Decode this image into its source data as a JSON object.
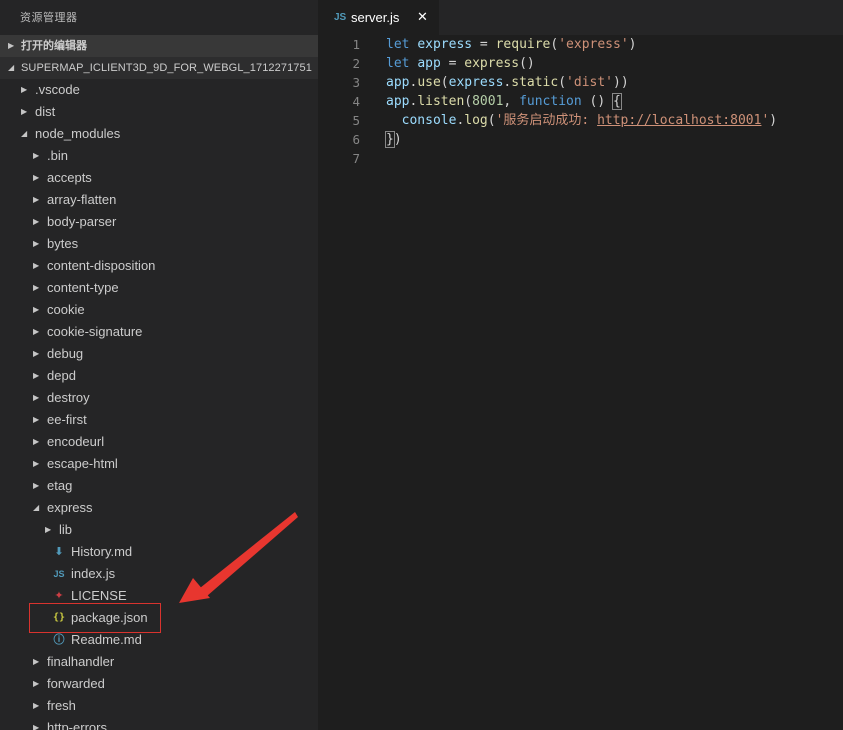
{
  "sidebar": {
    "title": "资源管理器",
    "open_editors": "打开的编辑器",
    "project": "SUPERMAP_ICLIENT3D_9D_FOR_WEBGL_1712271751",
    "tree": [
      {
        "label": ".vscode",
        "indent": 0,
        "kind": "folder",
        "open": false
      },
      {
        "label": "dist",
        "indent": 0,
        "kind": "folder",
        "open": false
      },
      {
        "label": "node_modules",
        "indent": 0,
        "kind": "folder",
        "open": true
      },
      {
        "label": ".bin",
        "indent": 1,
        "kind": "folder",
        "open": false
      },
      {
        "label": "accepts",
        "indent": 1,
        "kind": "folder",
        "open": false
      },
      {
        "label": "array-flatten",
        "indent": 1,
        "kind": "folder",
        "open": false
      },
      {
        "label": "body-parser",
        "indent": 1,
        "kind": "folder",
        "open": false
      },
      {
        "label": "bytes",
        "indent": 1,
        "kind": "folder",
        "open": false
      },
      {
        "label": "content-disposition",
        "indent": 1,
        "kind": "folder",
        "open": false
      },
      {
        "label": "content-type",
        "indent": 1,
        "kind": "folder",
        "open": false
      },
      {
        "label": "cookie",
        "indent": 1,
        "kind": "folder",
        "open": false
      },
      {
        "label": "cookie-signature",
        "indent": 1,
        "kind": "folder",
        "open": false
      },
      {
        "label": "debug",
        "indent": 1,
        "kind": "folder",
        "open": false
      },
      {
        "label": "depd",
        "indent": 1,
        "kind": "folder",
        "open": false
      },
      {
        "label": "destroy",
        "indent": 1,
        "kind": "folder",
        "open": false
      },
      {
        "label": "ee-first",
        "indent": 1,
        "kind": "folder",
        "open": false
      },
      {
        "label": "encodeurl",
        "indent": 1,
        "kind": "folder",
        "open": false
      },
      {
        "label": "escape-html",
        "indent": 1,
        "kind": "folder",
        "open": false
      },
      {
        "label": "etag",
        "indent": 1,
        "kind": "folder",
        "open": false
      },
      {
        "label": "express",
        "indent": 1,
        "kind": "folder",
        "open": true
      },
      {
        "label": "lib",
        "indent": 2,
        "kind": "folder",
        "open": false
      },
      {
        "label": "History.md",
        "indent": 2,
        "kind": "file",
        "icon": "markdown-arrow-icon"
      },
      {
        "label": "index.js",
        "indent": 2,
        "kind": "file",
        "icon": "js-file-icon"
      },
      {
        "label": "LICENSE",
        "indent": 2,
        "kind": "file",
        "icon": "license-icon"
      },
      {
        "label": "package.json",
        "indent": 2,
        "kind": "file",
        "icon": "json-file-icon"
      },
      {
        "label": "Readme.md",
        "indent": 2,
        "kind": "file",
        "icon": "info-icon"
      },
      {
        "label": "finalhandler",
        "indent": 1,
        "kind": "folder",
        "open": false
      },
      {
        "label": "forwarded",
        "indent": 1,
        "kind": "folder",
        "open": false
      },
      {
        "label": "fresh",
        "indent": 1,
        "kind": "folder",
        "open": false
      },
      {
        "label": "http-errors",
        "indent": 1,
        "kind": "folder",
        "open": false
      }
    ]
  },
  "editor": {
    "tab": {
      "icon_text": "JS",
      "label": "server.js",
      "close": "✕"
    },
    "lines": [
      {
        "n": "1",
        "tokens": [
          [
            "kw",
            "let"
          ],
          [
            "pl",
            " "
          ],
          [
            "var",
            "express"
          ],
          [
            "pl",
            " = "
          ],
          [
            "fn",
            "require"
          ],
          [
            "pl",
            "("
          ],
          [
            "str",
            "'express'"
          ],
          [
            "pl",
            ")"
          ]
        ]
      },
      {
        "n": "2",
        "tokens": [
          [
            "kw",
            "let"
          ],
          [
            "pl",
            " "
          ],
          [
            "var",
            "app"
          ],
          [
            "pl",
            " = "
          ],
          [
            "fn",
            "express"
          ],
          [
            "pl",
            "()"
          ]
        ]
      },
      {
        "n": "3",
        "tokens": [
          [
            "var",
            "app"
          ],
          [
            "pl",
            "."
          ],
          [
            "fn",
            "use"
          ],
          [
            "pl",
            "("
          ],
          [
            "var",
            "express"
          ],
          [
            "pl",
            "."
          ],
          [
            "fn",
            "static"
          ],
          [
            "pl",
            "("
          ],
          [
            "str",
            "'dist'"
          ],
          [
            "pl",
            "))"
          ]
        ]
      },
      {
        "n": "4",
        "tokens": [
          [
            "var",
            "app"
          ],
          [
            "pl",
            "."
          ],
          [
            "fn",
            "listen"
          ],
          [
            "pl",
            "("
          ],
          [
            "num",
            "8001"
          ],
          [
            "pl",
            ", "
          ],
          [
            "kw",
            "function"
          ],
          [
            "pl",
            " () "
          ],
          [
            "bm",
            "{"
          ]
        ]
      },
      {
        "n": "5",
        "tokens": [
          [
            "pl",
            "  "
          ],
          [
            "var",
            "console"
          ],
          [
            "pl",
            "."
          ],
          [
            "fn",
            "log"
          ],
          [
            "pl",
            "("
          ],
          [
            "str",
            "'服务启动成功: "
          ],
          [
            "url",
            "http://localhost:8001"
          ],
          [
            "str",
            "'"
          ],
          [
            "pl",
            ")"
          ]
        ]
      },
      {
        "n": "6",
        "tokens": [
          [
            "bm",
            "}"
          ],
          [
            "pl",
            ")"
          ]
        ]
      },
      {
        "n": "7",
        "tokens": []
      }
    ]
  },
  "colors": {
    "sidebar_bg": "#252526",
    "editor_bg": "#1e1e1e",
    "highlight_box": "#d9332e",
    "annotation_arrow": "#e8362f"
  }
}
